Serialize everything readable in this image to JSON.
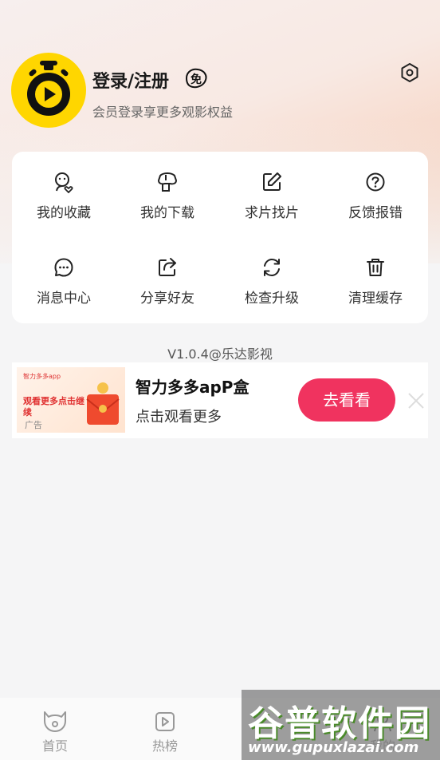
{
  "profile": {
    "title": "登录/注册",
    "vip_badge": "免",
    "subtitle": "会员登录享更多观影权益"
  },
  "menu": [
    {
      "label": "我的收藏",
      "icon": "favorite-user-icon"
    },
    {
      "label": "我的下载",
      "icon": "download-icon"
    },
    {
      "label": "求片找片",
      "icon": "edit-icon"
    },
    {
      "label": "反馈报错",
      "icon": "help-icon"
    },
    {
      "label": "消息中心",
      "icon": "message-icon"
    },
    {
      "label": "分享好友",
      "icon": "share-icon"
    },
    {
      "label": "检查升级",
      "icon": "refresh-icon"
    },
    {
      "label": "清理缓存",
      "icon": "trash-icon"
    }
  ],
  "version": "V1.0.4@乐达影视",
  "ad": {
    "thumb_title": "智力多多app",
    "thumb_text": "观看更多点击继续",
    "tag": "广告",
    "title": "智力多多apP盒",
    "subtitle": "点击观看更多",
    "button": "去看看"
  },
  "tabs": [
    {
      "label": "首页",
      "icon": "home-icon"
    },
    {
      "label": "热榜",
      "icon": "hot-list-icon"
    },
    {
      "label": "我的",
      "icon": "profile-icon"
    }
  ],
  "watermark": {
    "text": "谷普软件园",
    "url": "www.gupuxlazai.com"
  },
  "colors": {
    "accent": "#f0335f",
    "avatar_bg": "#ffd600"
  }
}
